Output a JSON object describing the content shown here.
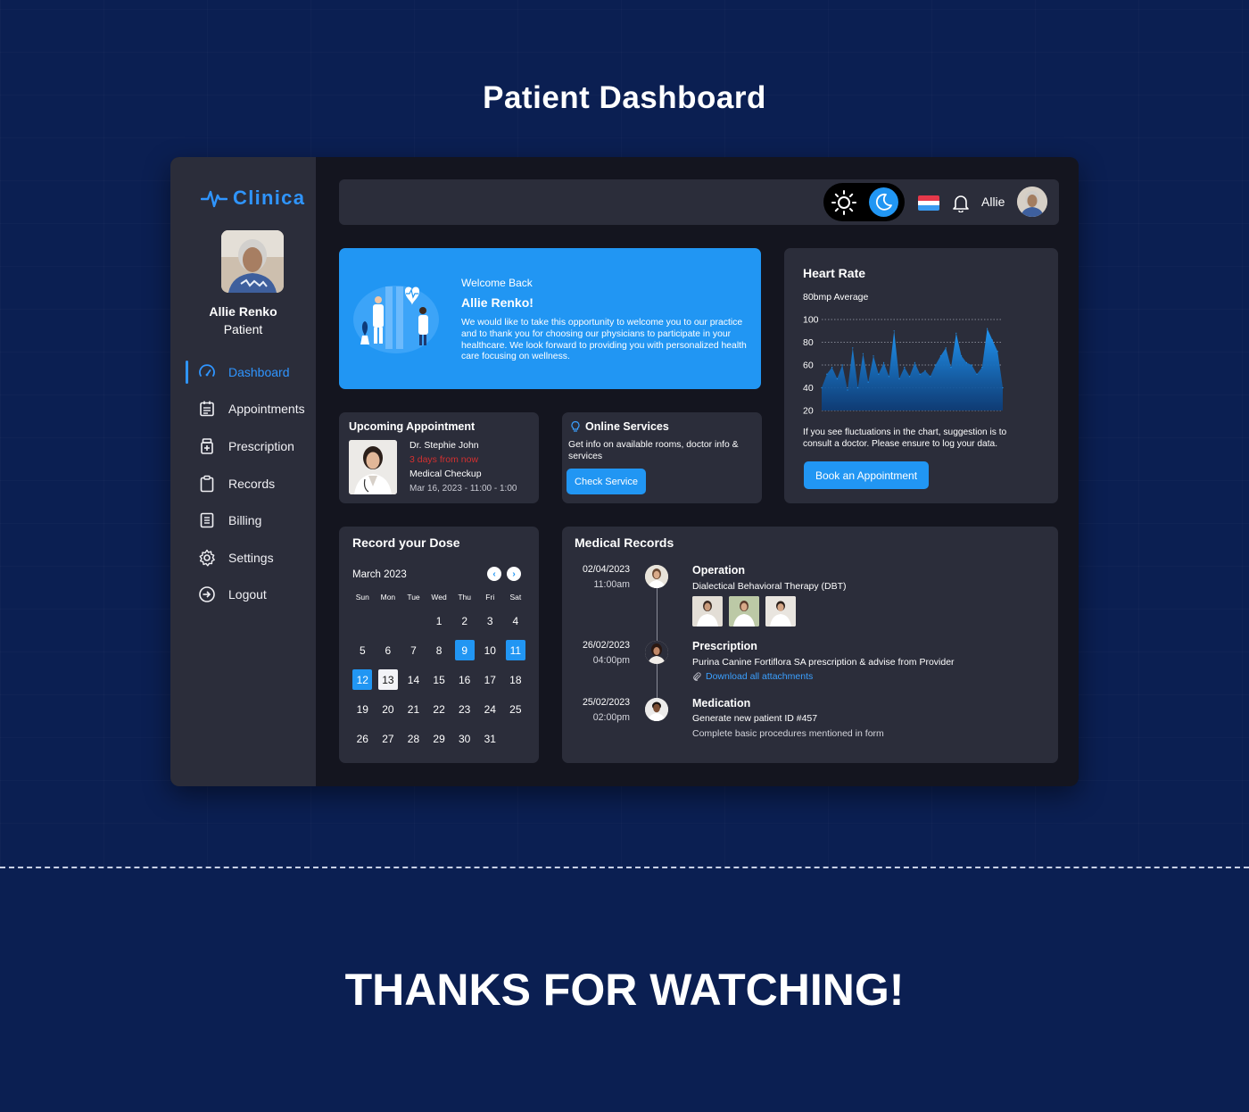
{
  "page": {
    "title": "Patient Dashboard",
    "footer": "THANKS FOR WATCHING!"
  },
  "app": {
    "brand": "Clinica",
    "colors": {
      "accent": "#2196f3",
      "panel": "#2b2d3a",
      "app_bg": "#14151f",
      "page_bg": "#0b1f52",
      "danger": "#d33030"
    }
  },
  "sidebar": {
    "profile": {
      "name": "Allie Renko",
      "role": "Patient"
    },
    "items": [
      {
        "label": "Dashboard",
        "icon": "gauge-icon",
        "active": true
      },
      {
        "label": "Appointments",
        "icon": "calendar-list-icon"
      },
      {
        "label": "Prescription",
        "icon": "medicine-bottle-icon"
      },
      {
        "label": "Records",
        "icon": "clipboard-icon"
      },
      {
        "label": "Billing",
        "icon": "document-icon"
      },
      {
        "label": "Settings",
        "icon": "gear-icon"
      },
      {
        "label": "Logout",
        "icon": "logout-icon"
      }
    ]
  },
  "topbar": {
    "theme": "dark",
    "user": "Allie"
  },
  "welcome": {
    "greeting": "Welcome Back",
    "name": "Allie Renko!",
    "message": "We would like to take this opportunity to welcome you to our practice and to thank you for choosing our physicians to participate in your healthcare. We look forward to providing you with personalized health care focusing on wellness."
  },
  "heart_rate": {
    "title": "Heart Rate",
    "average": "80bmp Average",
    "note": "If you see fluctuations in the chart, suggestion is to consult a doctor. Please ensure to log your data.",
    "button": "Book an Appointment"
  },
  "chart_data": {
    "type": "area",
    "title": "Heart Rate",
    "ylim": [
      20,
      100
    ],
    "yticks": [
      100,
      80,
      60,
      40,
      20
    ],
    "grid": true,
    "values": [
      40,
      52,
      58,
      48,
      60,
      38,
      75,
      40,
      70,
      45,
      68,
      52,
      62,
      50,
      90,
      48,
      58,
      50,
      62,
      52,
      55,
      50,
      60,
      68,
      75,
      58,
      88,
      68,
      62,
      60,
      52,
      58,
      92,
      82,
      72,
      40
    ]
  },
  "upcoming": {
    "title": "Upcoming Appointment",
    "doctor": "Dr. Stephie John",
    "when": "3 days from now",
    "type": "Medical Checkup",
    "datetime": "Mar 16, 2023 - 11:00 - 1:00"
  },
  "online_services": {
    "title": "Online Services",
    "desc": "Get info on available rooms, doctor info & services",
    "button": "Check Service"
  },
  "dose": {
    "title": "Record your Dose",
    "month": "March 2023",
    "weekdays": [
      "Sun",
      "Mon",
      "Tue",
      "Wed",
      "Thu",
      "Fri",
      "Sat"
    ],
    "first_weekday": 3,
    "days_in_month": 31,
    "selected": [
      9,
      11,
      12
    ],
    "today": 13
  },
  "records": {
    "title": "Medical Records",
    "items": [
      {
        "date": "02/04/2023",
        "time": "11:00am",
        "head": "Operation",
        "sub": "Dialectical Behavioral Therapy (DBT)"
      },
      {
        "date": "26/02/2023",
        "time": "04:00pm",
        "head": "Prescription",
        "sub": "Purina Canine Fortiflora SA prescription & advise from Provider",
        "link": "Download all attachments"
      },
      {
        "date": "25/02/2023",
        "time": "02:00pm",
        "head": "Medication",
        "sub": "Generate new patient ID #457",
        "sub2": "Complete basic procedures mentioned in form"
      }
    ]
  }
}
